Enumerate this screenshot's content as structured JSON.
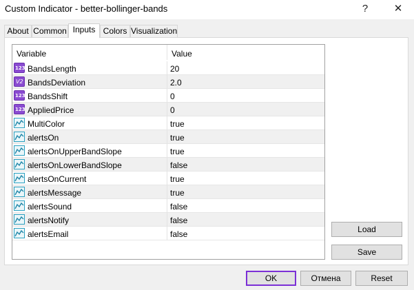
{
  "window": {
    "title": "Custom Indicator - better-bollinger-bands",
    "help_glyph": "?",
    "close_glyph": "✕"
  },
  "tabs": [
    {
      "label": "About"
    },
    {
      "label": "Common"
    },
    {
      "label": "Inputs"
    },
    {
      "label": "Colors"
    },
    {
      "label": "Visualization"
    }
  ],
  "active_tab": "Inputs",
  "grid": {
    "header_variable": "Variable",
    "header_value": "Value",
    "rows": [
      {
        "name": "BandsLength",
        "value": "20",
        "type": "int"
      },
      {
        "name": "BandsDeviation",
        "value": "2.0",
        "type": "double"
      },
      {
        "name": "BandsShift",
        "value": "0",
        "type": "int"
      },
      {
        "name": "AppliedPrice",
        "value": "0",
        "type": "int"
      },
      {
        "name": "MultiColor",
        "value": "true",
        "type": "bool"
      },
      {
        "name": "alertsOn",
        "value": "true",
        "type": "bool"
      },
      {
        "name": "alertsOnUpperBandSlope",
        "value": "true",
        "type": "bool"
      },
      {
        "name": "alertsOnLowerBandSlope",
        "value": "false",
        "type": "bool"
      },
      {
        "name": "alertsOnCurrent",
        "value": "true",
        "type": "bool"
      },
      {
        "name": "alertsMessage",
        "value": "true",
        "type": "bool"
      },
      {
        "name": "alertsSound",
        "value": "false",
        "type": "bool"
      },
      {
        "name": "alertsNotify",
        "value": "false",
        "type": "bool"
      },
      {
        "name": "alertsEmail",
        "value": "false",
        "type": "bool"
      }
    ]
  },
  "icon_text": {
    "int": "123",
    "double": "V2"
  },
  "buttons": {
    "load": "Load",
    "save": "Save",
    "ok": "OK",
    "cancel": "Отмена",
    "reset": "Reset"
  },
  "colors": {
    "ok_border": "#7b2fd6",
    "int_icon": "#8a4bd1",
    "bool_icon": "#2aa0c0"
  }
}
